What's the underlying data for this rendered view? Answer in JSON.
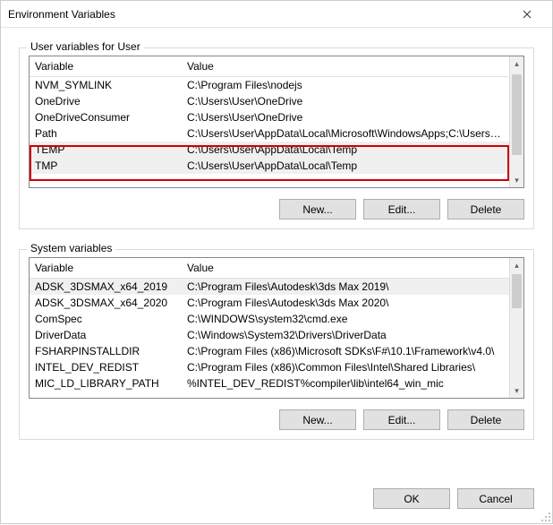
{
  "window": {
    "title": "Environment Variables"
  },
  "user_group": {
    "label": "User variables for User",
    "columns": {
      "variable": "Variable",
      "value": "Value"
    },
    "rows": [
      {
        "variable": "NVM_SYMLINK",
        "value": "C:\\Program Files\\nodejs"
      },
      {
        "variable": "OneDrive",
        "value": "C:\\Users\\User\\OneDrive"
      },
      {
        "variable": "OneDriveConsumer",
        "value": "C:\\Users\\User\\OneDrive"
      },
      {
        "variable": "Path",
        "value": "C:\\Users\\User\\AppData\\Local\\Microsoft\\WindowsApps;C:\\Users\\U..."
      },
      {
        "variable": "TEMP",
        "value": "C:\\Users\\User\\AppData\\Local\\Temp"
      },
      {
        "variable": "TMP",
        "value": "C:\\Users\\User\\AppData\\Local\\Temp"
      }
    ],
    "buttons": {
      "new": "New...",
      "edit": "Edit...",
      "delete": "Delete"
    }
  },
  "system_group": {
    "label": "System variables",
    "columns": {
      "variable": "Variable",
      "value": "Value"
    },
    "rows": [
      {
        "variable": "ADSK_3DSMAX_x64_2019",
        "value": "C:\\Program Files\\Autodesk\\3ds Max 2019\\"
      },
      {
        "variable": "ADSK_3DSMAX_x64_2020",
        "value": "C:\\Program Files\\Autodesk\\3ds Max 2020\\"
      },
      {
        "variable": "ComSpec",
        "value": "C:\\WINDOWS\\system32\\cmd.exe"
      },
      {
        "variable": "DriverData",
        "value": "C:\\Windows\\System32\\Drivers\\DriverData"
      },
      {
        "variable": "FSHARPINSTALLDIR",
        "value": "C:\\Program Files (x86)\\Microsoft SDKs\\F#\\10.1\\Framework\\v4.0\\"
      },
      {
        "variable": "INTEL_DEV_REDIST",
        "value": "C:\\Program Files (x86)\\Common Files\\Intel\\Shared Libraries\\"
      },
      {
        "variable": "MIC_LD_LIBRARY_PATH",
        "value": "%INTEL_DEV_REDIST%compiler\\lib\\intel64_win_mic"
      }
    ],
    "buttons": {
      "new": "New...",
      "edit": "Edit...",
      "delete": "Delete"
    }
  },
  "footer": {
    "ok": "OK",
    "cancel": "Cancel"
  }
}
